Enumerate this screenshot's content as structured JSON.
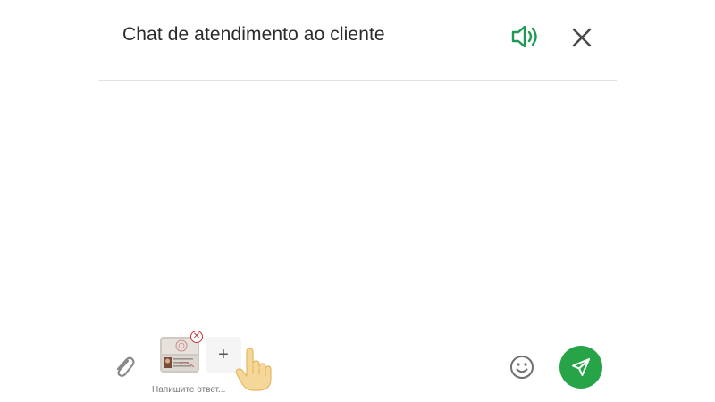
{
  "header": {
    "title": "Chat de atendimento ao cliente",
    "sound_icon": "speaker-volume-icon",
    "close_icon": "close-icon"
  },
  "messages": [],
  "composer": {
    "attach_icon": "paperclip-icon",
    "attachments": [
      {
        "type": "image",
        "preview": "id-document-photo",
        "remove_icon": "remove-x-icon"
      }
    ],
    "add_icon": "plus-icon",
    "placeholder": "Напишите ответ...",
    "value": "",
    "emoji_icon": "smiley-icon",
    "send_icon": "paper-plane-icon"
  },
  "colors": {
    "accent_green": "#27a348",
    "sound_icon_green": "#1f9a54",
    "remove_red": "#c23b3b",
    "divider": "#e3e3e3"
  }
}
